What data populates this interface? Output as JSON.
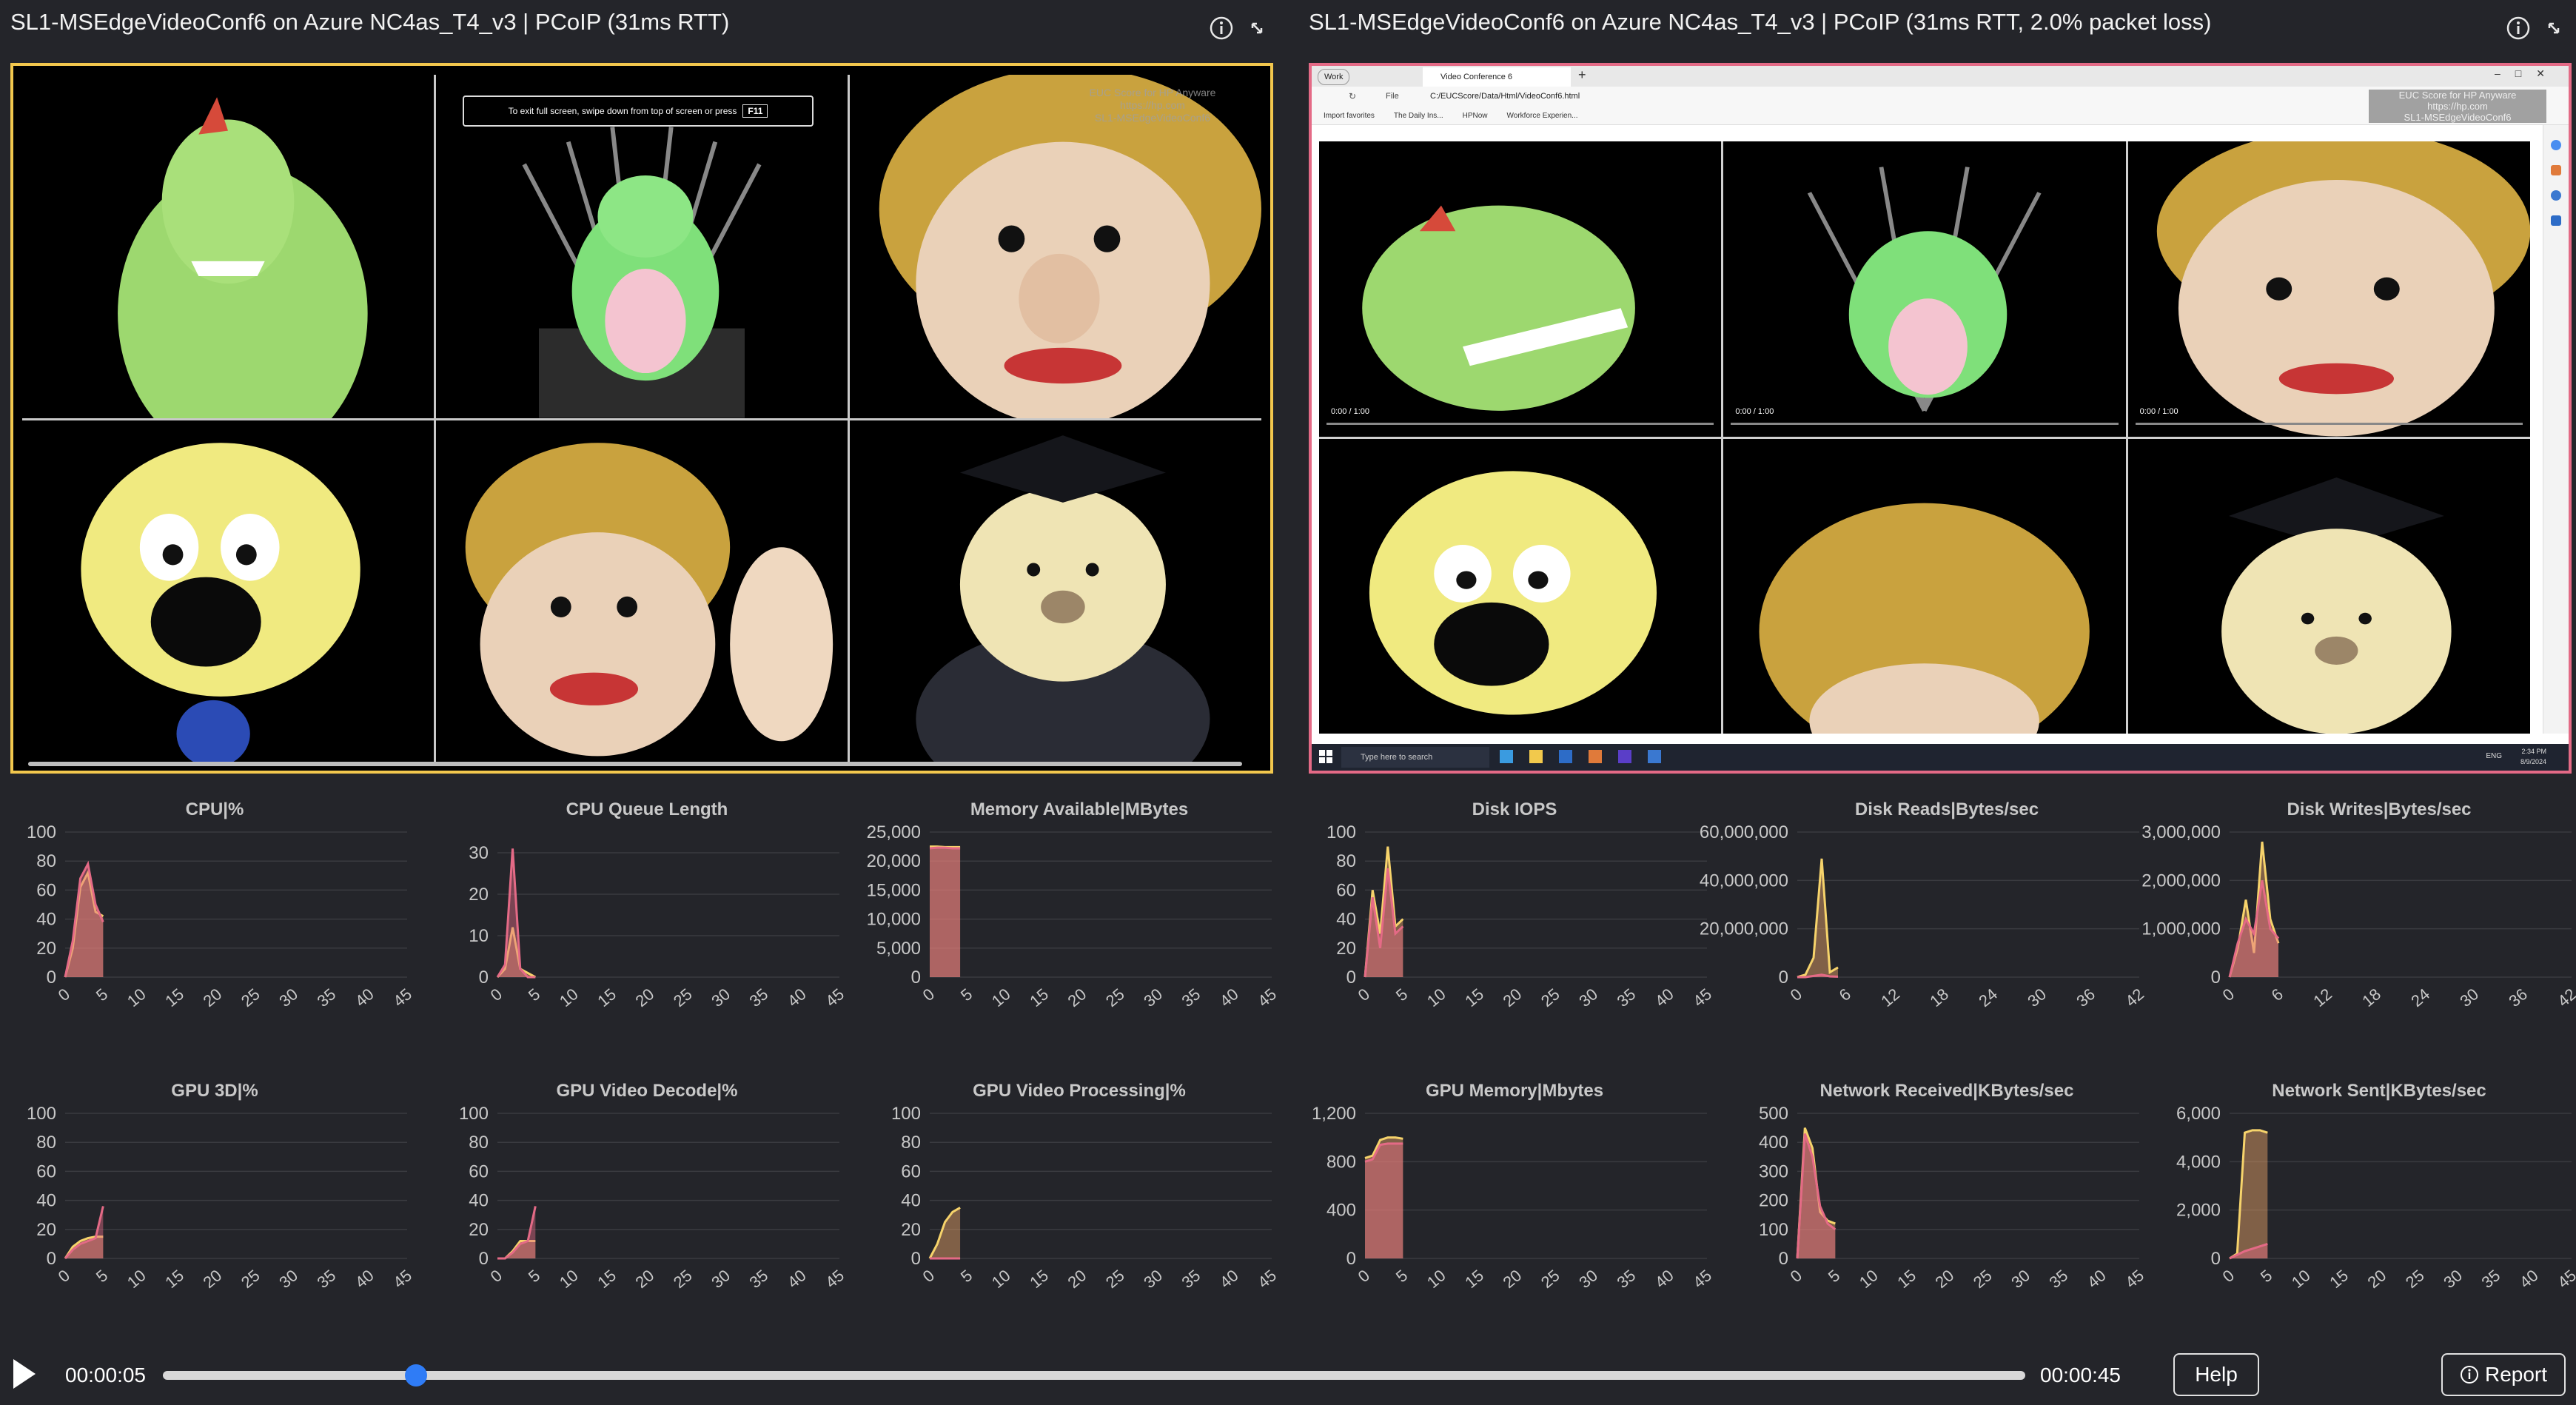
{
  "left_panel": {
    "title": "SL1-MSEdgeVideoConf6 on Azure NC4as_T4_v3 | PCoIP (31ms RTT)",
    "fullscreen_hint": "To exit full screen, swipe down from top of screen or press",
    "fullscreen_key": "F11",
    "watermark": [
      "EUC Score for HP Anyware",
      "https://hp.com",
      "SL1-MSEdgeVideoConf6"
    ]
  },
  "right_panel": {
    "title": "SL1-MSEdgeVideoConf6 on Azure NC4as_T4_v3 | PCoIP (31ms RTT, 2.0% packet loss)",
    "browser": {
      "profile": "Work",
      "tab_title": "Video Conference 6",
      "address": "C:/EUCScore/Data/Html/VideoConf6.html",
      "file_label": "File",
      "bookmarks": [
        "Import favorites",
        "The Daily Ins...",
        "HPNow",
        "Workforce Experien..."
      ]
    },
    "video_time": "0:00 / 1:00",
    "watermark": [
      "EUC Score for HP Anyware",
      "https://hp.com",
      "SL1-MSEdgeVideoConf6"
    ],
    "taskbar": {
      "search_placeholder": "Type here to search",
      "lang": "ENG",
      "time": "2:34 PM",
      "date": "8/9/2024"
    }
  },
  "colors": {
    "series_a": "#f2a96b",
    "series_b": "#e46a86",
    "left_border": "#f2c74d",
    "right_border": "#e46a86",
    "accent": "#2f7cf6"
  },
  "chart_data": [
    {
      "id": "cpu",
      "type": "area",
      "title": "CPU|%",
      "ylim": [
        0,
        100
      ],
      "yticks": [
        "100",
        "80",
        "60",
        "40",
        "20",
        "0"
      ],
      "xlim": [
        0,
        45
      ],
      "xticks": [
        "0",
        "5",
        "10",
        "15",
        "20",
        "25",
        "30",
        "35",
        "40",
        "45"
      ],
      "series": [
        {
          "x": [
            0,
            1,
            2,
            3,
            4,
            5
          ],
          "y": [
            0,
            20,
            62,
            72,
            45,
            42
          ]
        },
        {
          "x": [
            0,
            1,
            2,
            3,
            4,
            5
          ],
          "y": [
            0,
            25,
            68,
            78,
            50,
            38
          ]
        }
      ]
    },
    {
      "id": "cpuq",
      "type": "area",
      "title": "CPU Queue Length",
      "ylim": [
        0,
        35
      ],
      "yticks": [
        "30",
        "20",
        "10",
        "0"
      ],
      "ytick_vals": [
        30,
        20,
        10,
        0
      ],
      "xlim": [
        0,
        45
      ],
      "xticks": [
        "0",
        "5",
        "10",
        "15",
        "20",
        "25",
        "30",
        "35",
        "40",
        "45"
      ],
      "series": [
        {
          "x": [
            0,
            1,
            2,
            3,
            4,
            5
          ],
          "y": [
            0,
            2,
            12,
            2,
            1,
            0
          ]
        },
        {
          "x": [
            0,
            1,
            2,
            3,
            4,
            5
          ],
          "y": [
            0,
            3,
            31,
            2,
            0,
            0
          ]
        }
      ]
    },
    {
      "id": "mem",
      "type": "area",
      "title": "Memory Available|MBytes",
      "ylim": [
        0,
        25000
      ],
      "yticks": [
        "25,000",
        "20,000",
        "15,000",
        "10,000",
        "5,000",
        "0"
      ],
      "xlim": [
        0,
        45
      ],
      "xticks": [
        "0",
        "5",
        "10",
        "15",
        "20",
        "25",
        "30",
        "35",
        "40",
        "45"
      ],
      "series": [
        {
          "x": [
            0,
            1,
            2,
            3,
            4
          ],
          "y": [
            22500,
            22500,
            22400,
            22400,
            22400
          ]
        },
        {
          "x": [
            0,
            1,
            2,
            3,
            4
          ],
          "y": [
            22200,
            22300,
            22300,
            22200,
            22200
          ]
        }
      ]
    },
    {
      "id": "iops",
      "type": "area",
      "title": "Disk IOPS",
      "ylim": [
        0,
        100
      ],
      "yticks": [
        "100",
        "80",
        "60",
        "40",
        "20",
        "0"
      ],
      "xlim": [
        0,
        45
      ],
      "xticks": [
        "0",
        "5",
        "10",
        "15",
        "20",
        "25",
        "30",
        "35",
        "40",
        "45"
      ],
      "series": [
        {
          "x": [
            0,
            1,
            2,
            3,
            4,
            5
          ],
          "y": [
            0,
            60,
            30,
            90,
            35,
            40
          ]
        },
        {
          "x": [
            0,
            1,
            2,
            3,
            4,
            5
          ],
          "y": [
            0,
            55,
            20,
            75,
            30,
            35
          ]
        }
      ]
    },
    {
      "id": "dread",
      "type": "area",
      "title": "Disk Reads|Bytes/sec",
      "ylim": [
        0,
        60000000
      ],
      "yticks": [
        "60,000,000",
        "40,000,000",
        "20,000,000",
        "0"
      ],
      "ytick_vals": [
        60000000,
        40000000,
        20000000,
        0
      ],
      "xlim": [
        0,
        42
      ],
      "xticks": [
        "0",
        "6",
        "12",
        "18",
        "24",
        "30",
        "36",
        "42"
      ],
      "series": [
        {
          "x": [
            0,
            1,
            2,
            3,
            4,
            5
          ],
          "y": [
            0,
            1000000,
            8000000,
            49000000,
            2000000,
            4000000
          ]
        },
        {
          "x": [
            0,
            1,
            2,
            3,
            4,
            5
          ],
          "y": [
            0,
            0,
            500000,
            1000000,
            300000,
            200000
          ]
        }
      ]
    },
    {
      "id": "dwrite",
      "type": "area",
      "title": "Disk Writes|Bytes/sec",
      "ylim": [
        0,
        3000000
      ],
      "yticks": [
        "3,000,000",
        "2,000,000",
        "1,000,000",
        "0"
      ],
      "ytick_vals": [
        3000000,
        2000000,
        1000000,
        0
      ],
      "xlim": [
        0,
        42
      ],
      "xticks": [
        "0",
        "6",
        "12",
        "18",
        "24",
        "30",
        "36",
        "42"
      ],
      "series": [
        {
          "x": [
            0,
            1,
            2,
            3,
            4,
            5,
            6
          ],
          "y": [
            0,
            600000,
            1600000,
            500000,
            2800000,
            1200000,
            700000
          ]
        },
        {
          "x": [
            0,
            1,
            2,
            3,
            4,
            5,
            6
          ],
          "y": [
            0,
            700000,
            1200000,
            900000,
            2000000,
            1000000,
            800000
          ]
        }
      ]
    },
    {
      "id": "gpu3d",
      "type": "area",
      "title": "GPU 3D|%",
      "ylim": [
        0,
        100
      ],
      "yticks": [
        "100",
        "80",
        "60",
        "40",
        "20",
        "0"
      ],
      "xlim": [
        0,
        45
      ],
      "xticks": [
        "0",
        "5",
        "10",
        "15",
        "20",
        "25",
        "30",
        "35",
        "40",
        "45"
      ],
      "series": [
        {
          "x": [
            0,
            1,
            2,
            3,
            4,
            5
          ],
          "y": [
            0,
            8,
            12,
            14,
            15,
            15
          ]
        },
        {
          "x": [
            0,
            1,
            2,
            3,
            4,
            5
          ],
          "y": [
            0,
            6,
            10,
            12,
            14,
            36
          ]
        }
      ]
    },
    {
      "id": "gpudec",
      "type": "area",
      "title": "GPU Video Decode|%",
      "ylim": [
        0,
        100
      ],
      "yticks": [
        "100",
        "80",
        "60",
        "40",
        "20",
        "0"
      ],
      "xlim": [
        0,
        45
      ],
      "xticks": [
        "0",
        "5",
        "10",
        "15",
        "20",
        "25",
        "30",
        "35",
        "40",
        "45"
      ],
      "series": [
        {
          "x": [
            0,
            1,
            2,
            3,
            4,
            5
          ],
          "y": [
            0,
            0,
            5,
            12,
            12,
            12
          ]
        },
        {
          "x": [
            0,
            1,
            2,
            3,
            4,
            5
          ],
          "y": [
            0,
            0,
            4,
            10,
            12,
            36
          ]
        }
      ]
    },
    {
      "id": "gpuproc",
      "type": "area",
      "title": "GPU Video Processing|%",
      "ylim": [
        0,
        100
      ],
      "yticks": [
        "100",
        "80",
        "60",
        "40",
        "20",
        "0"
      ],
      "xlim": [
        0,
        45
      ],
      "xticks": [
        "0",
        "5",
        "10",
        "15",
        "20",
        "25",
        "30",
        "35",
        "40",
        "45"
      ],
      "series": [
        {
          "x": [
            0,
            1,
            2,
            3,
            4
          ],
          "y": [
            0,
            10,
            25,
            32,
            35
          ]
        },
        {
          "x": [
            0,
            1,
            2,
            3,
            4
          ],
          "y": [
            0,
            0,
            0,
            0,
            0
          ]
        }
      ]
    },
    {
      "id": "gpumem",
      "type": "area",
      "title": "GPU Memory|Mbytes",
      "ylim": [
        0,
        1200
      ],
      "yticks": [
        "1,200",
        "800",
        "400",
        "0"
      ],
      "ytick_vals": [
        1200,
        800,
        400,
        0
      ],
      "xlim": [
        0,
        45
      ],
      "xticks": [
        "0",
        "5",
        "10",
        "15",
        "20",
        "25",
        "30",
        "35",
        "40",
        "45"
      ],
      "series": [
        {
          "x": [
            0,
            1,
            2,
            3,
            4,
            5
          ],
          "y": [
            830,
            850,
            980,
            1000,
            1000,
            990
          ]
        },
        {
          "x": [
            0,
            1,
            2,
            3,
            4,
            5
          ],
          "y": [
            800,
            820,
            940,
            950,
            950,
            950
          ]
        }
      ]
    },
    {
      "id": "netrx",
      "type": "area",
      "title": "Network Received|KBytes/sec",
      "ylim": [
        0,
        500
      ],
      "yticks": [
        "500",
        "400",
        "300",
        "200",
        "100",
        "0"
      ],
      "xlim": [
        0,
        45
      ],
      "xticks": [
        "0",
        "5",
        "10",
        "15",
        "20",
        "25",
        "30",
        "35",
        "40",
        "45"
      ],
      "series": [
        {
          "x": [
            0,
            1,
            2,
            3,
            4,
            5
          ],
          "y": [
            0,
            450,
            380,
            160,
            130,
            120
          ]
        },
        {
          "x": [
            0,
            1,
            2,
            3,
            4,
            5
          ],
          "y": [
            0,
            430,
            350,
            180,
            120,
            100
          ]
        }
      ]
    },
    {
      "id": "nettx",
      "type": "area",
      "title": "Network Sent|KBytes/sec",
      "ylim": [
        0,
        6000
      ],
      "yticks": [
        "6,000",
        "4,000",
        "2,000",
        "0"
      ],
      "ytick_vals": [
        6000,
        4000,
        2000,
        0
      ],
      "xlim": [
        0,
        45
      ],
      "xticks": [
        "0",
        "5",
        "10",
        "15",
        "20",
        "25",
        "30",
        "35",
        "40",
        "45"
      ],
      "series": [
        {
          "x": [
            0,
            1,
            2,
            3,
            4,
            5
          ],
          "y": [
            0,
            200,
            5200,
            5300,
            5300,
            5200
          ]
        },
        {
          "x": [
            0,
            1,
            2,
            3,
            4,
            5
          ],
          "y": [
            0,
            150,
            300,
            400,
            500,
            600
          ]
        }
      ]
    }
  ],
  "player": {
    "current_time": "00:00:05",
    "total_time": "00:00:45",
    "progress": 0.136,
    "help_label": "Help",
    "report_label": "Report"
  }
}
